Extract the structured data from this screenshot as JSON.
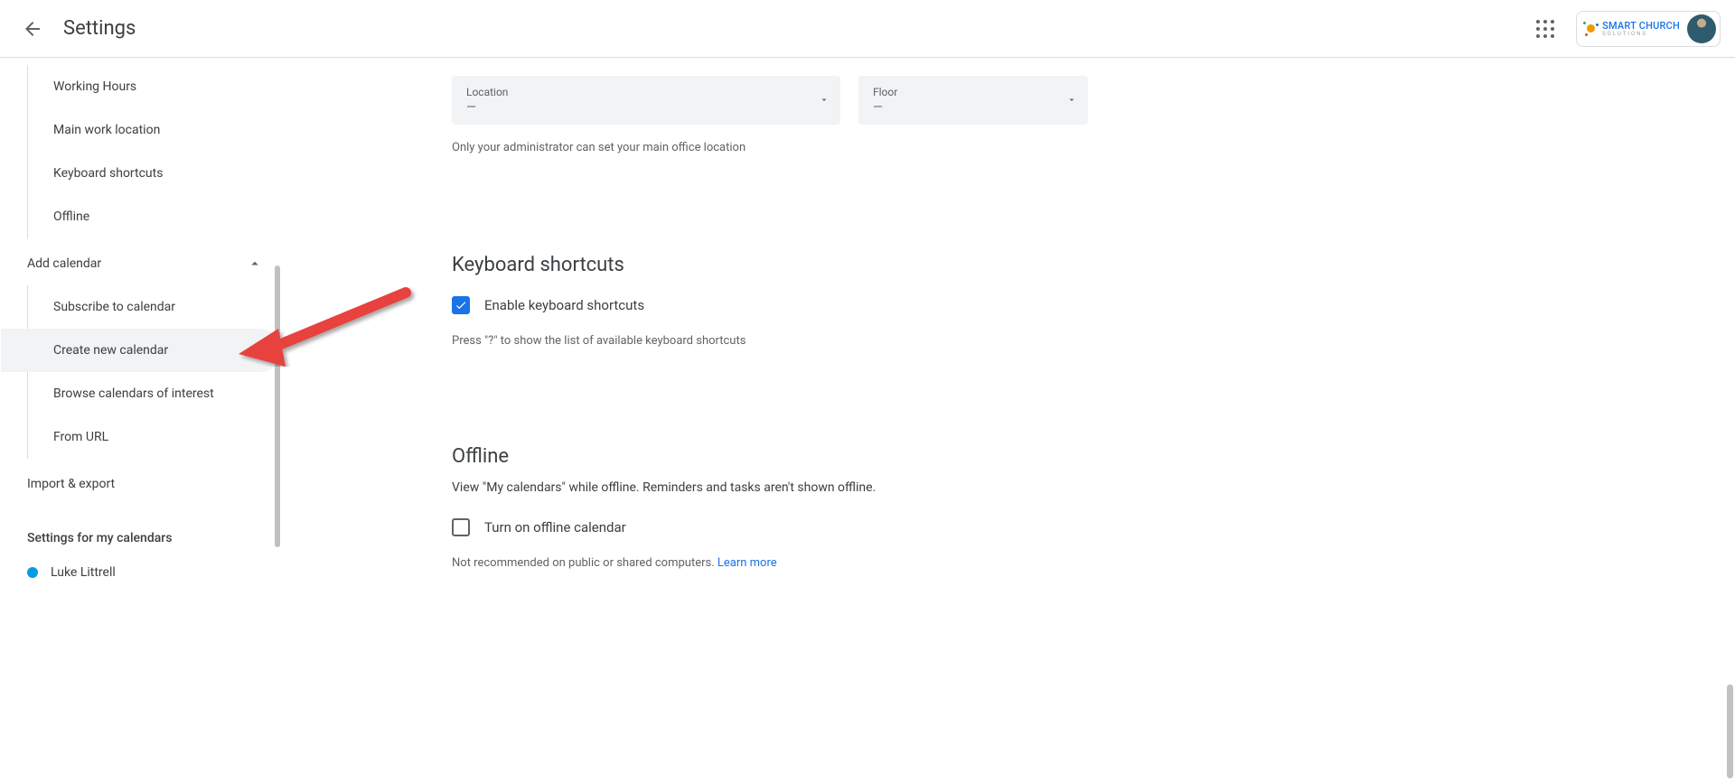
{
  "header": {
    "title": "Settings",
    "brand_name": "SMART CHURCH",
    "brand_sub": "SOLUTIONS"
  },
  "sidebar": {
    "general_items": [
      "Working Hours",
      "Main work location",
      "Keyboard shortcuts",
      "Offline"
    ],
    "add_calendar_label": "Add calendar",
    "add_calendar_items": [
      "Subscribe to calendar",
      "Create new calendar",
      "Browse calendars of interest",
      "From URL"
    ],
    "import_export": "Import & export",
    "section_label": "Settings for my calendars",
    "calendar_name": "Luke Littrell"
  },
  "location": {
    "label": "Location",
    "value": "—",
    "floor_label": "Floor",
    "floor_value": "—",
    "helper": "Only your administrator can set your main office location"
  },
  "shortcuts": {
    "heading": "Keyboard shortcuts",
    "enable_label": "Enable keyboard shortcuts",
    "helper": "Press \"?\" to show the list of available keyboard shortcuts"
  },
  "offline": {
    "heading": "Offline",
    "desc": "View \"My calendars\" while offline. Reminders and tasks aren't shown offline.",
    "toggle_label": "Turn on offline calendar",
    "helper_prefix": "Not recommended on public or shared computers. ",
    "learn_more": "Learn more"
  }
}
